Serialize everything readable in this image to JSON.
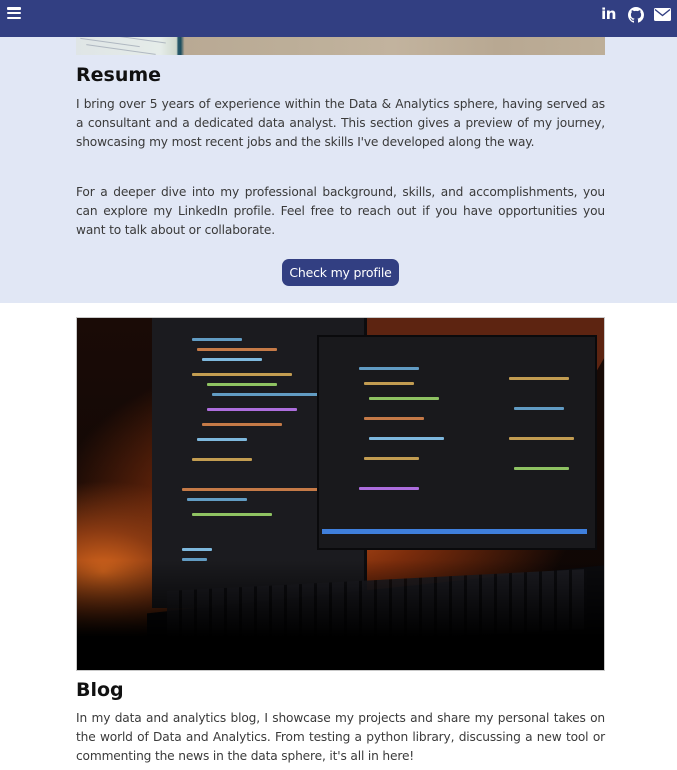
{
  "navbar": {
    "menu_icon": "hamburger-menu-icon",
    "social_links": [
      {
        "name": "linkedin",
        "icon": "linkedin-icon",
        "text": "in"
      },
      {
        "name": "github",
        "icon": "github-icon"
      },
      {
        "name": "email",
        "icon": "envelope-icon"
      }
    ],
    "background_color": "#323f82"
  },
  "resume": {
    "title": "Resume",
    "paragraphs": [
      "I bring over 5 years of experience within the Data & Analytics sphere, having served as a consultant and a dedicated data analyst. This section gives a preview of my journey, showcasing my most recent jobs and the skills I've developed along the way.",
      "For a deeper dive into my professional background, skills, and accomplishments, you can explore my LinkedIn profile. Feel free to reach out if you have opportunities you want to talk about or collaborate."
    ],
    "button_label": "Check my profile",
    "background_color": "#e1e7f5"
  },
  "blog": {
    "image_alt": "Computer monitors with code and backlit keyboard",
    "title": "Blog",
    "paragraph": "In my data and analytics blog, I showcase my projects and share my personal takes on the world of Data and Analytics. From testing a python library, discussing a new tool or commenting the news in the data sphere, it's all in here!"
  }
}
